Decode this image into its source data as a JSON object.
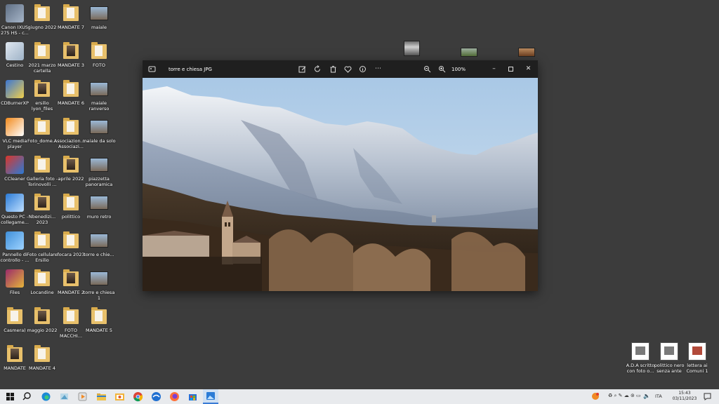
{
  "desktop": {
    "icons": [
      {
        "label": "Canon IXUS 275 HS - c...",
        "icon": "camera-app-icon"
      },
      {
        "label": "giugno 2022",
        "icon": "folder-icon"
      },
      {
        "label": "MANDATE 7",
        "icon": "folder-icon"
      },
      {
        "label": "maiale",
        "icon": "photo-icon"
      },
      {
        "label": "Cestino",
        "icon": "recycle-bin-icon"
      },
      {
        "label": "2021 marzo cartella",
        "icon": "folder-icon"
      },
      {
        "label": "MANDATE 3",
        "icon": "folder-icon"
      },
      {
        "label": "FOTO",
        "icon": "folder-icon"
      },
      {
        "label": "CDBurnerXP",
        "icon": "cdburner-icon"
      },
      {
        "label": "ersilio lyon_files",
        "icon": "folder-icon"
      },
      {
        "label": "MANDATE 6",
        "icon": "folder-icon"
      },
      {
        "label": "maiale ranverso",
        "icon": "photo-icon"
      },
      {
        "label": "VLC media player",
        "icon": "vlc-icon"
      },
      {
        "label": "Foto_dome...",
        "icon": "folder-icon"
      },
      {
        "label": "Associazion... - Associazi...",
        "icon": "folder-icon"
      },
      {
        "label": "maiale da solo",
        "icon": "photo-icon"
      },
      {
        "label": "CCleaner",
        "icon": "ccleaner-icon"
      },
      {
        "label": "Galleria foto - Torinovolli ...",
        "icon": "folder-icon"
      },
      {
        "label": "aprile 2022",
        "icon": "folder-icon"
      },
      {
        "label": "piazzetta panoramica",
        "icon": "photo-icon"
      },
      {
        "label": "Questo PC - collegame...",
        "icon": "computer-icon"
      },
      {
        "label": "Nbenedizi... 2023",
        "icon": "folder-icon"
      },
      {
        "label": "polittico",
        "icon": "folder-icon"
      },
      {
        "label": "muro retro",
        "icon": "photo-icon"
      },
      {
        "label": "Pannello di controllo - ...",
        "icon": "control-panel-icon"
      },
      {
        "label": "Foto cellulare Ersilio",
        "icon": "folder-icon"
      },
      {
        "label": "focara 2023",
        "icon": "folder-icon"
      },
      {
        "label": "torre e chie...",
        "icon": "photo-icon"
      },
      {
        "label": "Files",
        "icon": "winrar-icon"
      },
      {
        "label": "Locandine",
        "icon": "folder-icon"
      },
      {
        "label": "MANDATE 2",
        "icon": "folder-icon"
      },
      {
        "label": "torre e chiesa 1",
        "icon": "photo-icon"
      },
      {
        "label": "Casmera)",
        "icon": "folder-icon"
      },
      {
        "label": "maggio 2022",
        "icon": "folder-icon"
      },
      {
        "label": "FOTO MACCHI...",
        "icon": "folder-icon"
      },
      {
        "label": "MANDATE 5",
        "icon": "folder-icon"
      },
      {
        "label": "MANDATE",
        "icon": "folder-icon"
      },
      {
        "label": "MANDATE 4",
        "icon": "folder-icon"
      }
    ],
    "files_right": [
      {
        "label": "A.D.A scritto con foto o...",
        "icon": "document-icon"
      },
      {
        "label": "polittico nero senza ante",
        "icon": "document-icon"
      },
      {
        "label": "lettera ai Comuni 1",
        "icon": "document-icon"
      }
    ]
  },
  "viewer": {
    "title": "torre e chiesa JPG",
    "zoom": "100%",
    "toolbar": [
      "edit-icon",
      "rotate-icon",
      "delete-icon",
      "favorite-icon",
      "info-icon",
      "more-icon"
    ],
    "colors": {
      "bar": "#1f1f1f",
      "sky": "#b9d3ea"
    }
  },
  "taskbar": {
    "language": "ITA",
    "time": "15:43",
    "date": "03/11/2023"
  }
}
